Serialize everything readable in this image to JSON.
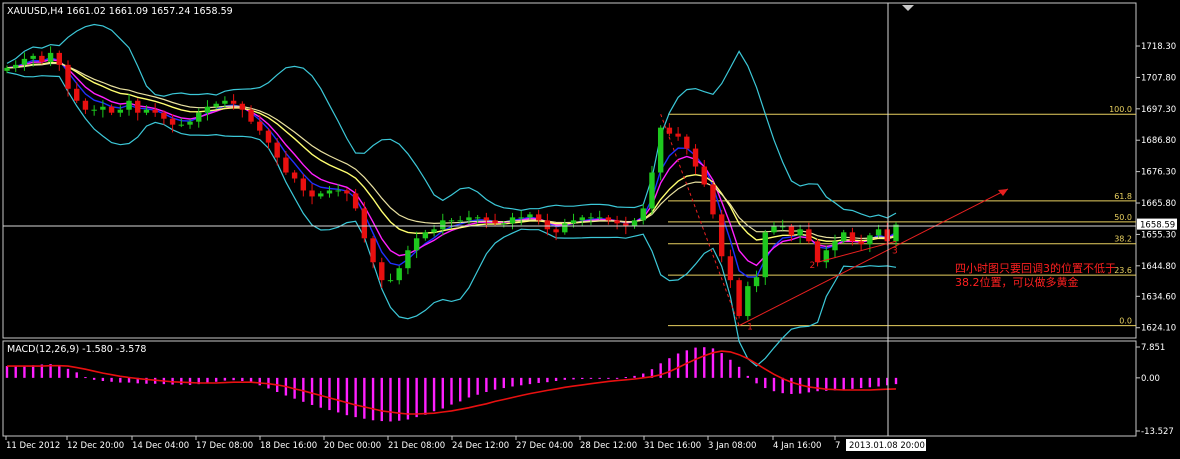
{
  "colors": {
    "background": "#000000",
    "frame": "#c8c8c8",
    "bull": "#1ec81e",
    "bear": "#e81010",
    "bollinger": "#3cc8d8",
    "ma_fast": "#2030ff",
    "ma_magenta": "#ff20ff",
    "ma_yellow": "#ffff70",
    "ma_beige": "#e8e0a0",
    "fib": "#e8d060",
    "trend": "#e82020",
    "annotation": "#ff2020",
    "macd_hist": "#ff20ff",
    "macd_signal": "#e81010"
  },
  "chart_data": [
    {
      "type": "candlestick",
      "title": "XAUUSD,H4  1661.02 1661.09 1657.24 1658.59",
      "symbol": "XAUUSD,H4",
      "ohlc_current": {
        "open": 1661.02,
        "high": 1661.09,
        "low": 1657.24,
        "close": 1658.59
      },
      "price_label": "1658.59",
      "y_ticks": [
        "1718.30",
        "1707.80",
        "1697.30",
        "1686.80",
        "1676.30",
        "1665.80",
        "1655.30",
        "1644.80",
        "1634.60",
        "1624.10"
      ],
      "x_ticks": [
        "11 Dec 2012",
        "12 Dec 20:00",
        "14 Dec 04:00",
        "17 Dec 08:00",
        "18 Dec 16:00",
        "20 Dec 00:00",
        "21 Dec 08:00",
        "24 Dec 12:00",
        "27 Dec 04:00",
        "28 Dec 12:00",
        "31 Dec 16:00",
        "3 Jan 08:00",
        "4 Jan 16:00",
        "7",
        "2013.01.08 20:00"
      ],
      "cursor_time": "2013.01.08 20:00",
      "ylim": [
        1622,
        1727
      ],
      "close_series": [
        1711,
        1712,
        1714,
        1715,
        1713,
        1716,
        1712,
        1704,
        1700,
        1697,
        1697,
        1698,
        1696,
        1697,
        1700,
        1696,
        1697,
        1696,
        1694,
        1692,
        1692,
        1693,
        1696,
        1698,
        1699,
        1700,
        1699,
        1697,
        1693,
        1690,
        1686,
        1681,
        1676,
        1674,
        1670,
        1668,
        1669,
        1670,
        1670,
        1669,
        1664,
        1654,
        1646,
        1640,
        1640,
        1644,
        1650,
        1654,
        1656,
        1657,
        1660,
        1660,
        1660,
        1661,
        1661,
        1660,
        1659,
        1659,
        1661,
        1661,
        1662,
        1660,
        1657,
        1656,
        1659,
        1660,
        1661,
        1661,
        1661,
        1660,
        1659,
        1658,
        1660,
        1664,
        1676,
        1691,
        1689,
        1688,
        1684,
        1678,
        1672,
        1662,
        1648,
        1640,
        1628,
        1638,
        1641,
        1656,
        1658,
        1658,
        1655,
        1657,
        1653,
        1646,
        1650,
        1653,
        1656,
        1653,
        1652,
        1655,
        1657,
        1653,
        1658.59
      ],
      "fibonacci": [
        {
          "label": "100.0",
          "price": 1695.5
        },
        {
          "label": "61.8",
          "price": 1666.5
        },
        {
          "label": "50.0",
          "price": 1659.5
        },
        {
          "label": "38.2",
          "price": 1652.2
        },
        {
          "label": "23.6",
          "price": 1641.7
        },
        {
          "label": "0.0",
          "price": 1624.8
        }
      ],
      "wave_labels": [
        "1",
        "2",
        "3"
      ],
      "annotation": "四小时图只要回调3的位置不低于38.2位置，可以做多黄金"
    },
    {
      "type": "bar",
      "title": "MACD(12,26,9) -1.580 -3.578",
      "y_ticks": [
        "7.851",
        "0.00",
        "-13.527"
      ],
      "ylim": [
        -13.527,
        7.851
      ],
      "histogram": [
        3.0,
        3.0,
        3.0,
        3.2,
        3.4,
        3.5,
        3.1,
        2.3,
        1.4,
        0.2,
        -0.5,
        -0.8,
        -1.0,
        -1.2,
        -1.2,
        -1.4,
        -1.5,
        -1.5,
        -1.6,
        -1.7,
        -1.7,
        -1.8,
        -1.6,
        -1.3,
        -1.0,
        -0.7,
        -0.6,
        -0.8,
        -1.3,
        -1.9,
        -2.7,
        -3.6,
        -4.5,
        -5.3,
        -6.1,
        -6.9,
        -7.6,
        -8.2,
        -8.8,
        -9.5,
        -10.0,
        -10.4,
        -10.8,
        -11.0,
        -11.1,
        -10.9,
        -10.6,
        -10.0,
        -9.4,
        -8.5,
        -7.8,
        -6.8,
        -6.0,
        -5.0,
        -4.3,
        -3.6,
        -3.0,
        -2.6,
        -2.2,
        -1.9,
        -1.6,
        -1.3,
        -1.1,
        -0.8,
        -0.5,
        -0.4,
        -0.3,
        -0.2,
        -0.1,
        0.0,
        0.0,
        0.2,
        0.5,
        1.1,
        2.2,
        3.7,
        5.0,
        6.2,
        7.0,
        7.7,
        7.8,
        7.5,
        6.3,
        4.6,
        2.8,
        0.5,
        -1.4,
        -2.6,
        -3.4,
        -3.9,
        -4.1,
        -4.0,
        -3.7,
        -3.4,
        -3.3,
        -3.2,
        -3.0,
        -2.8,
        -2.6,
        -2.4,
        -2.2,
        -1.9,
        -1.6
      ],
      "signal": [
        3.0,
        3.0,
        3.0,
        3.0,
        3.0,
        3.1,
        3.1,
        3.0,
        2.6,
        2.2,
        1.7,
        1.2,
        0.8,
        0.4,
        0.1,
        -0.2,
        -0.4,
        -0.6,
        -0.8,
        -1.0,
        -1.1,
        -1.2,
        -1.3,
        -1.3,
        -1.3,
        -1.2,
        -1.1,
        -1.1,
        -1.1,
        -1.3,
        -1.5,
        -1.8,
        -2.2,
        -2.8,
        -3.3,
        -3.9,
        -4.5,
        -5.1,
        -5.7,
        -6.3,
        -6.9,
        -7.4,
        -7.9,
        -8.4,
        -8.7,
        -9.0,
        -9.2,
        -9.2,
        -9.1,
        -9.0,
        -8.7,
        -8.4,
        -8.0,
        -7.6,
        -7.1,
        -6.6,
        -6.0,
        -5.5,
        -5.0,
        -4.5,
        -4.0,
        -3.6,
        -3.2,
        -2.8,
        -2.4,
        -2.1,
        -1.8,
        -1.5,
        -1.2,
        -0.9,
        -0.7,
        -0.5,
        -0.3,
        0.0,
        0.3,
        0.8,
        1.6,
        2.6,
        3.7,
        4.7,
        5.6,
        6.4,
        6.8,
        6.6,
        5.9,
        4.9,
        3.6,
        2.2,
        0.9,
        -0.2,
        -1.1,
        -1.8,
        -2.3,
        -2.6,
        -2.9,
        -3.0,
        -3.1,
        -3.1,
        -3.1,
        -3.1,
        -3.0,
        -2.9,
        -2.8
      ]
    }
  ]
}
